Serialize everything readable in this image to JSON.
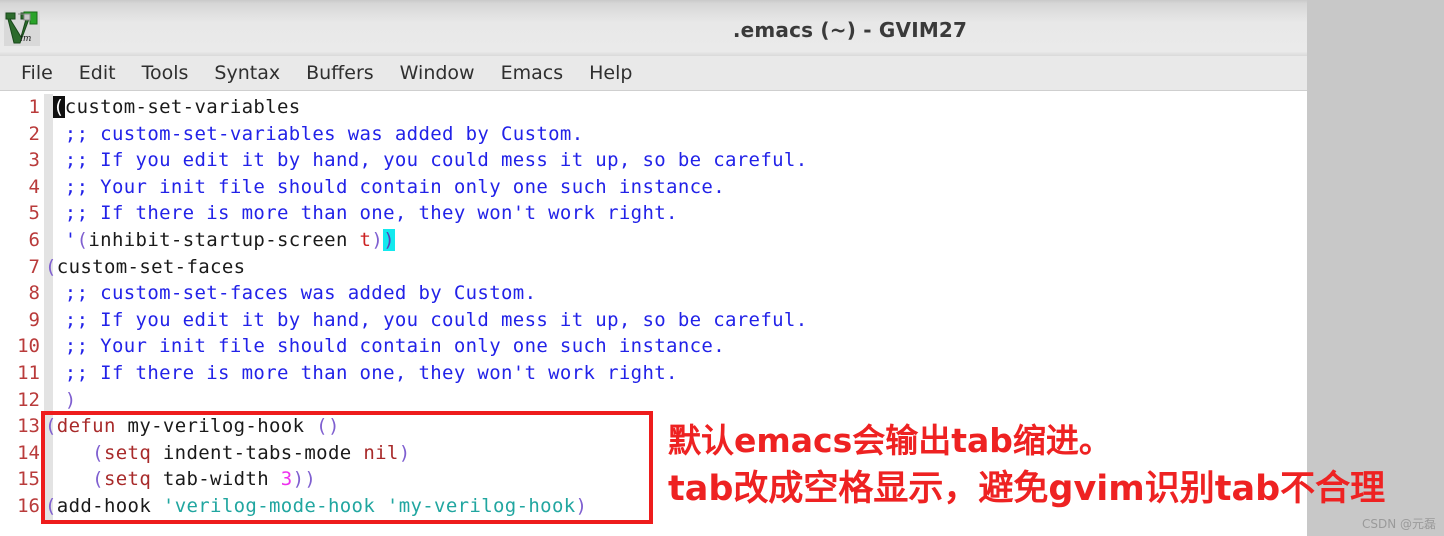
{
  "window": {
    "title": ".emacs (~) - GVIM27",
    "app_icon": "gvim-logo-icon"
  },
  "menu": {
    "items": [
      {
        "label": "File"
      },
      {
        "label": "Edit"
      },
      {
        "label": "Tools"
      },
      {
        "label": "Syntax"
      },
      {
        "label": "Buffers"
      },
      {
        "label": "Window"
      },
      {
        "label": "Emacs"
      },
      {
        "label": "Help"
      }
    ]
  },
  "editor": {
    "line_numbers": [
      "1",
      "2",
      "3",
      "4",
      "5",
      "6",
      "7",
      "8",
      "9",
      "10",
      "11",
      "12",
      "13",
      "14",
      "15",
      "16"
    ],
    "lines": [
      {
        "num": "1",
        "text": "(custom-set-variables"
      },
      {
        "num": "2",
        "text": " ;; custom-set-variables was added by Custom."
      },
      {
        "num": "3",
        "text": " ;; If you edit it by hand, you could mess it up, so be careful."
      },
      {
        "num": "4",
        "text": " ;; Your init file should contain only one such instance."
      },
      {
        "num": "5",
        "text": " ;; If there is more than one, they won't work right."
      },
      {
        "num": "6",
        "text": " '(inhibit-startup-screen t))"
      },
      {
        "num": "7",
        "text": "(custom-set-faces"
      },
      {
        "num": "8",
        "text": " ;; custom-set-faces was added by Custom."
      },
      {
        "num": "9",
        "text": " ;; If you edit it by hand, you could mess it up, so be careful."
      },
      {
        "num": "10",
        "text": " ;; Your init file should contain only one such instance."
      },
      {
        "num": "11",
        "text": " ;; If there is more than one, they won't work right."
      },
      {
        "num": "12",
        "text": " )"
      },
      {
        "num": "13",
        "text": "(defun my-verilog-hook ()"
      },
      {
        "num": "14",
        "text": "    (setq indent-tabs-mode nil)"
      },
      {
        "num": "15",
        "text": "    (setq tab-width 3))"
      },
      {
        "num": "16",
        "text": "(add-hook 'verilog-mode-hook 'my-verilog-hook)"
      }
    ],
    "tokens": {
      "l1_cursor": "(",
      "l1_rest": "custom-set-variables",
      "l2": ";; custom-set-variables was added by Custom.",
      "l3": ";; If you edit it by hand, you could mess it up, so be careful.",
      "l4": ";; Your init file should contain only one such instance.",
      "l5": ";; If there is more than one, they won't work right.",
      "l6_quote": "'",
      "l6_open": "(",
      "l6_name": "inhibit-startup-screen ",
      "l6_t": "t",
      "l6_close1": ")",
      "l6_close2": ")",
      "l7_open": "(",
      "l7_name": "custom-set-faces",
      "l8": ";; custom-set-faces was added by Custom.",
      "l9": ";; If you edit it by hand, you could mess it up, so be careful.",
      "l10": ";; Your init file should contain only one such instance.",
      "l11": ";; If there is more than one, they won't work right.",
      "l12_close": ")",
      "l13_open": "(",
      "l13_kw": "defun",
      "l13_name": " my-verilog-hook ",
      "l13_args": "()",
      "l14_indent": "    ",
      "l14_open": "(",
      "l14_kw": "setq",
      "l14_name": " indent-tabs-mode ",
      "l14_nil": "nil",
      "l14_close": ")",
      "l15_indent": "    ",
      "l15_open": "(",
      "l15_kw": "setq",
      "l15_name": " tab-width ",
      "l15_num": "3",
      "l15_close": "))",
      "l16_open": "(",
      "l16_fn": "add-hook ",
      "l16_sym1": "'verilog-mode-hook",
      "l16_space": " ",
      "l16_sym2": "'my-verilog-hook",
      "l16_close": ")"
    }
  },
  "annotation": {
    "line1": "默认emacs会输出tab缩进。",
    "line2": "tab改成空格显示，避免gvim识别tab不合理",
    "color": "#ee2222",
    "box_color": "#ee1c1c"
  },
  "watermark": {
    "text": "CSDN @元磊"
  },
  "colors": {
    "comment": "#2222e8",
    "paren": "#7f5fd0",
    "keyword": "#a82a2a",
    "number": "#ee30ee",
    "quoted_symbol": "#21a6a0",
    "line_number": "#b93b3b",
    "match_paren_bg": "#12e9ee",
    "cursor_bg": "#101010",
    "desktop_bg": "#c8c8c8"
  }
}
